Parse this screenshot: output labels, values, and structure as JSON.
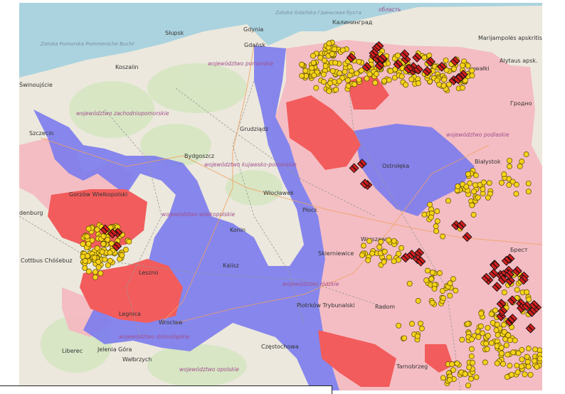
{
  "colors": {
    "land": "#ece8dd",
    "sea": "#aad3df",
    "forest": "#d6e6c2",
    "zone_pink": "#f4b8c0",
    "zone_blue": "#7b7bee",
    "zone_red": "#f25c5c",
    "point_fill": "#f6d21a",
    "point_stroke": "#5a4a00",
    "marker_fill": "#d41f1f"
  },
  "legend": {
    "points": "yellow-circle-icon",
    "markers": "red-hatched-diamond-icon"
  },
  "labels": {
    "seas": [
      "Zatoka Pomorska Pommersche Bucht",
      "Zatoka Gdańska Гданьская бухта"
    ],
    "cities": [
      "Gdynia",
      "Gdańsk",
      "Słupsk",
      "Koszalin",
      "Калининград",
      "Szczecin",
      "Świnoujście",
      "Gorzów Wielkopolski",
      "Bydgoszcz",
      "Grudziądz",
      "Włocławek",
      "Płock",
      "Ostrołęka",
      "Białystok",
      "Гродно",
      "Брест",
      "Suwałki",
      "Alytaus apsk.",
      "Marijampolės apskritis",
      "Konin",
      "Kalisz",
      "Leszno",
      "Legnica",
      "Wrocław",
      "Cottbus Chóśebuz",
      "Piotrków Trybunalski",
      "Radom",
      "Skierniewice",
      "Warszawa",
      "Liberec",
      "Jelenia Góra",
      "Wałbrzych",
      "Częstochowa",
      "Tarnobrzeg",
      "область",
      "denburg"
    ],
    "regions": [
      "województwo pomorskie",
      "województwo zachodniopomorskie",
      "województwo kujawsko-pomorskie",
      "województwo wielkopolskie",
      "województwo podlaskie",
      "województwo łódzkie",
      "województwo dolnośląskie",
      "województwo opolskie"
    ]
  }
}
